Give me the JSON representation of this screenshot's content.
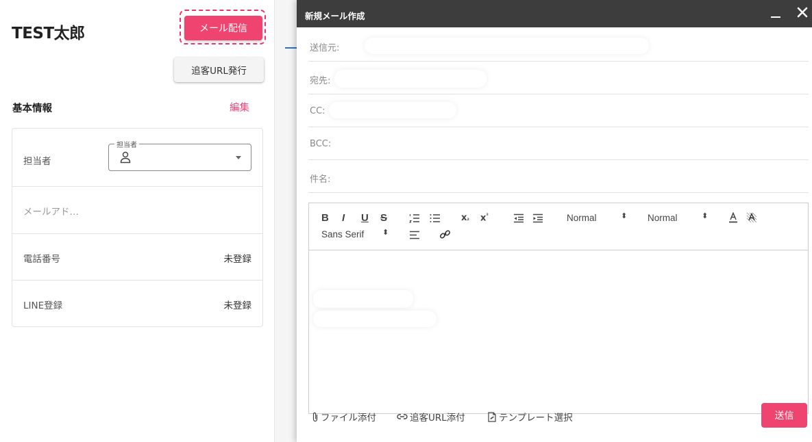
{
  "customer": {
    "name": "TEST太郎"
  },
  "buttons": {
    "mail": "メール配信",
    "tracking_url": "追客URL発行",
    "send": "送信"
  },
  "basic_info": {
    "title": "基本情報",
    "edit": "編集",
    "rows": [
      {
        "label": "担当者",
        "field_legend": "担当者"
      },
      {
        "label": "メールアド…",
        "value": ""
      },
      {
        "label": "電話番号",
        "value": "未登録"
      },
      {
        "label": "LINE登録",
        "value": "未登録"
      }
    ]
  },
  "compose": {
    "title": "新規メール作成",
    "fields": {
      "from": "送信元:",
      "to": "宛先:",
      "cc": "CC:",
      "bcc": "BCC:",
      "subject": "件名:"
    },
    "toolbar": {
      "bold": "B",
      "italic": "I",
      "underline": "U",
      "strike": "S",
      "size": "Normal",
      "heading": "Normal",
      "font": "Sans Serif"
    },
    "footer": {
      "attach_file": "ファイル添付",
      "attach_url": "追客URL添付",
      "template": "テンプレート選択"
    }
  },
  "colors": {
    "accent": "#f04470",
    "header": "#3d3d3d"
  },
  "icons": [
    "person-icon",
    "chevron-down-icon",
    "minimize-icon",
    "close-icon",
    "paperclip-icon",
    "link-icon",
    "template-icon"
  ]
}
